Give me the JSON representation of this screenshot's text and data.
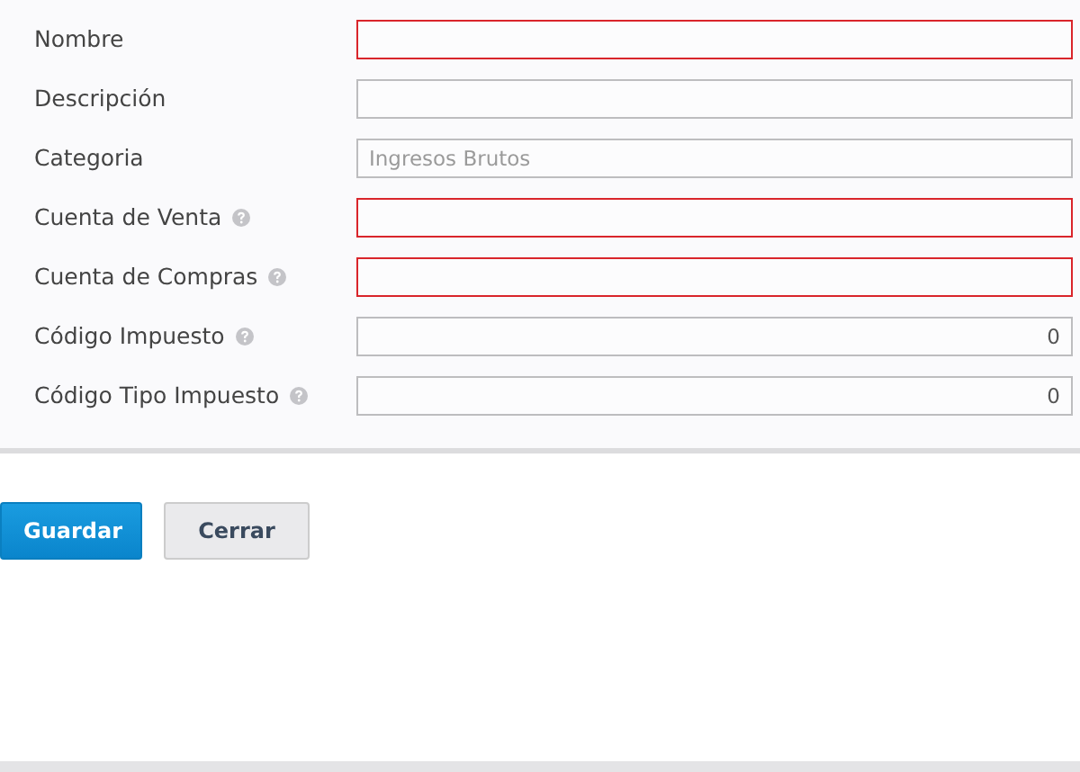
{
  "fields": [
    {
      "label": "Nombre",
      "invalid": true,
      "help": false
    },
    {
      "label": "Descripción",
      "invalid": false,
      "help": false
    },
    {
      "label": "Categoria",
      "invalid": false,
      "help": false,
      "placeholder": "Ingresos Brutos"
    },
    {
      "label": "Cuenta de Venta",
      "invalid": true,
      "help": true
    },
    {
      "label": "Cuenta de Compras",
      "invalid": true,
      "help": true
    },
    {
      "label": "Código Impuesto",
      "invalid": false,
      "help": true,
      "value": "0"
    },
    {
      "label": "Código Tipo Impuesto",
      "invalid": false,
      "help": true,
      "value": "0"
    }
  ],
  "buttons": [
    {
      "label": "Guardar",
      "kind": "primary"
    },
    {
      "label": "Cerrar",
      "kind": "default"
    }
  ]
}
